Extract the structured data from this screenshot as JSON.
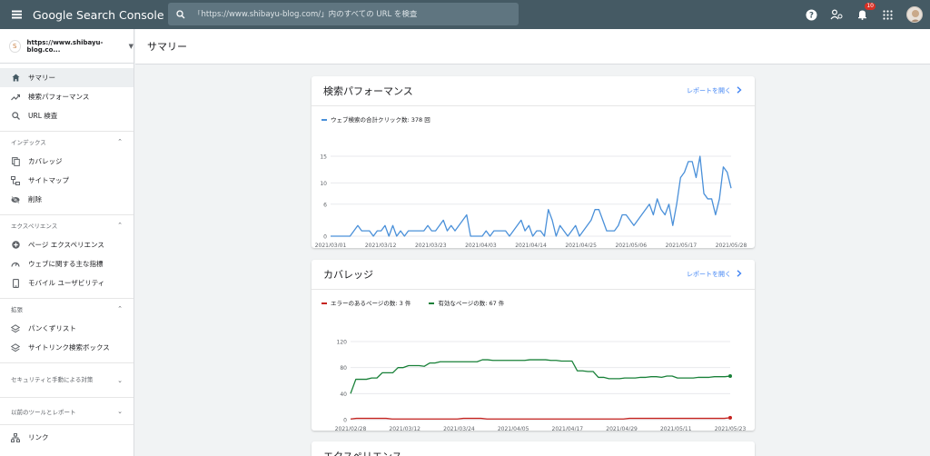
{
  "app": {
    "title": "Google Search Console"
  },
  "search": {
    "placeholder": "「https://www.shibayu-blog.com/」内のすべての URL を検査"
  },
  "topbar": {
    "notification_count": "10"
  },
  "property": {
    "url": "https://www.shibayu-blog.co..."
  },
  "page": {
    "title": "サマリー"
  },
  "sidebar": {
    "items_top": [
      {
        "label": "サマリー",
        "icon": "home-icon"
      },
      {
        "label": "検索パフォーマンス",
        "icon": "trending-up-icon"
      },
      {
        "label": "URL 検査",
        "icon": "search-icon"
      }
    ],
    "section_index": {
      "label": "インデックス"
    },
    "items_index": [
      {
        "label": "カバレッジ",
        "icon": "file-copy-icon"
      },
      {
        "label": "サイトマップ",
        "icon": "sitemap-icon"
      },
      {
        "label": "削除",
        "icon": "visibility-off-icon"
      }
    ],
    "section_experience": {
      "label": "エクスペリエンス"
    },
    "items_experience": [
      {
        "label": "ページ エクスペリエンス",
        "icon": "add-circle-icon"
      },
      {
        "label": "ウェブに関する主な指標",
        "icon": "speed-icon"
      },
      {
        "label": "モバイル ユーザビリティ",
        "icon": "smartphone-icon"
      }
    ],
    "section_enhancements": {
      "label": "拡張"
    },
    "items_enhancements": [
      {
        "label": "パンくずリスト",
        "icon": "layers-icon"
      },
      {
        "label": "サイトリンク検索ボックス",
        "icon": "layers-icon"
      }
    ],
    "section_security": {
      "label": "セキュリティと手動による対策"
    },
    "section_legacy": {
      "label": "以前のツールとレポート"
    },
    "items_links": [
      {
        "label": "リンク",
        "icon": "links-icon"
      }
    ]
  },
  "cards": {
    "performance": {
      "title": "検索パフォーマンス",
      "link": "レポートを開く"
    },
    "coverage": {
      "title": "カバレッジ",
      "link": "レポートを開く"
    },
    "experience": {
      "title": "エクスペリエンス"
    }
  },
  "colors": {
    "topbar": "#455a64",
    "link": "#4285f4",
    "clicks": "#4a90d9",
    "error": "#c5221f",
    "valid": "#188038"
  },
  "chart_data": [
    {
      "type": "line",
      "legend": [
        {
          "name": "ウェブ検索の合計クリック数: 378 回",
          "color": "#4a90d9"
        }
      ],
      "x_tick_labels": [
        "2021/03/01",
        "2021/03/12",
        "2021/03/23",
        "2021/04/03",
        "2021/04/14",
        "2021/04/25",
        "2021/05/06",
        "2021/05/17",
        "2021/05/28"
      ],
      "y_tick_labels": [
        "0",
        "6",
        "10",
        "15"
      ],
      "ylim": [
        0,
        15
      ],
      "grid": true,
      "series": [
        {
          "name": "ウェブ検索の合計クリック数: 378 回",
          "values": [
            0,
            0,
            0,
            0,
            0,
            0,
            1,
            2,
            1,
            1,
            1,
            0,
            1,
            1,
            2,
            0,
            2,
            0,
            1,
            0,
            1,
            1,
            1,
            1,
            1,
            2,
            1,
            1,
            2,
            3,
            1,
            2,
            1,
            2,
            3,
            4,
            0,
            0,
            0,
            0,
            1,
            0,
            1,
            1,
            1,
            1,
            0,
            1,
            2,
            3,
            1,
            2,
            0,
            1,
            1,
            0,
            5,
            3,
            0,
            2,
            1,
            0,
            1,
            2,
            0,
            1,
            2,
            3,
            5,
            5,
            3,
            1,
            1,
            1,
            2,
            4,
            4,
            3,
            2,
            3,
            4,
            5,
            6,
            4,
            7,
            5,
            4,
            6,
            2,
            6,
            11,
            12,
            14,
            14,
            11,
            15,
            8,
            7,
            7,
            4,
            7,
            13,
            12,
            9
          ]
        }
      ]
    },
    {
      "type": "line",
      "legend": [
        {
          "name": "エラーのあるページの数: 3 件",
          "color": "#c5221f"
        },
        {
          "name": "有効なページの数: 67 件",
          "color": "#188038"
        }
      ],
      "x_tick_labels": [
        "2021/02/28",
        "2021/03/12",
        "2021/03/24",
        "2021/04/05",
        "2021/04/17",
        "2021/04/29",
        "2021/05/11",
        "2021/05/23"
      ],
      "y_tick_labels": [
        "0",
        "40",
        "80",
        "120"
      ],
      "ylim": [
        0,
        120
      ],
      "grid": true,
      "series": [
        {
          "name": "エラーのあるページの数: 3 件",
          "values": [
            1,
            2,
            2,
            2,
            2,
            2,
            2,
            1,
            1,
            1,
            1,
            1,
            1,
            1,
            1,
            1,
            1,
            1,
            1,
            2,
            2,
            2,
            2,
            1,
            1,
            1,
            1,
            1,
            1,
            1,
            1,
            1,
            1,
            1,
            1,
            1,
            1,
            1,
            1,
            1,
            1,
            1,
            1,
            1,
            1,
            1,
            1,
            2,
            2,
            2,
            2,
            2,
            2,
            2,
            2,
            2,
            2,
            2,
            2,
            2,
            2,
            2,
            2,
            2,
            3
          ]
        },
        {
          "name": "有効なページの数: 67 件",
          "values": [
            40,
            62,
            62,
            62,
            64,
            64,
            72,
            72,
            72,
            80,
            80,
            83,
            83,
            83,
            82,
            87,
            87,
            89,
            89,
            89,
            89,
            89,
            89,
            89,
            89,
            92,
            92,
            91,
            91,
            91,
            91,
            91,
            91,
            91,
            92,
            92,
            92,
            92,
            91,
            91,
            90,
            90,
            90,
            75,
            75,
            74,
            74,
            65,
            65,
            63,
            63,
            63,
            64,
            64,
            64,
            65,
            65,
            66,
            66,
            65,
            67,
            67,
            64,
            64,
            64,
            64,
            65,
            65,
            65,
            66,
            66,
            66,
            67
          ]
        }
      ]
    }
  ]
}
